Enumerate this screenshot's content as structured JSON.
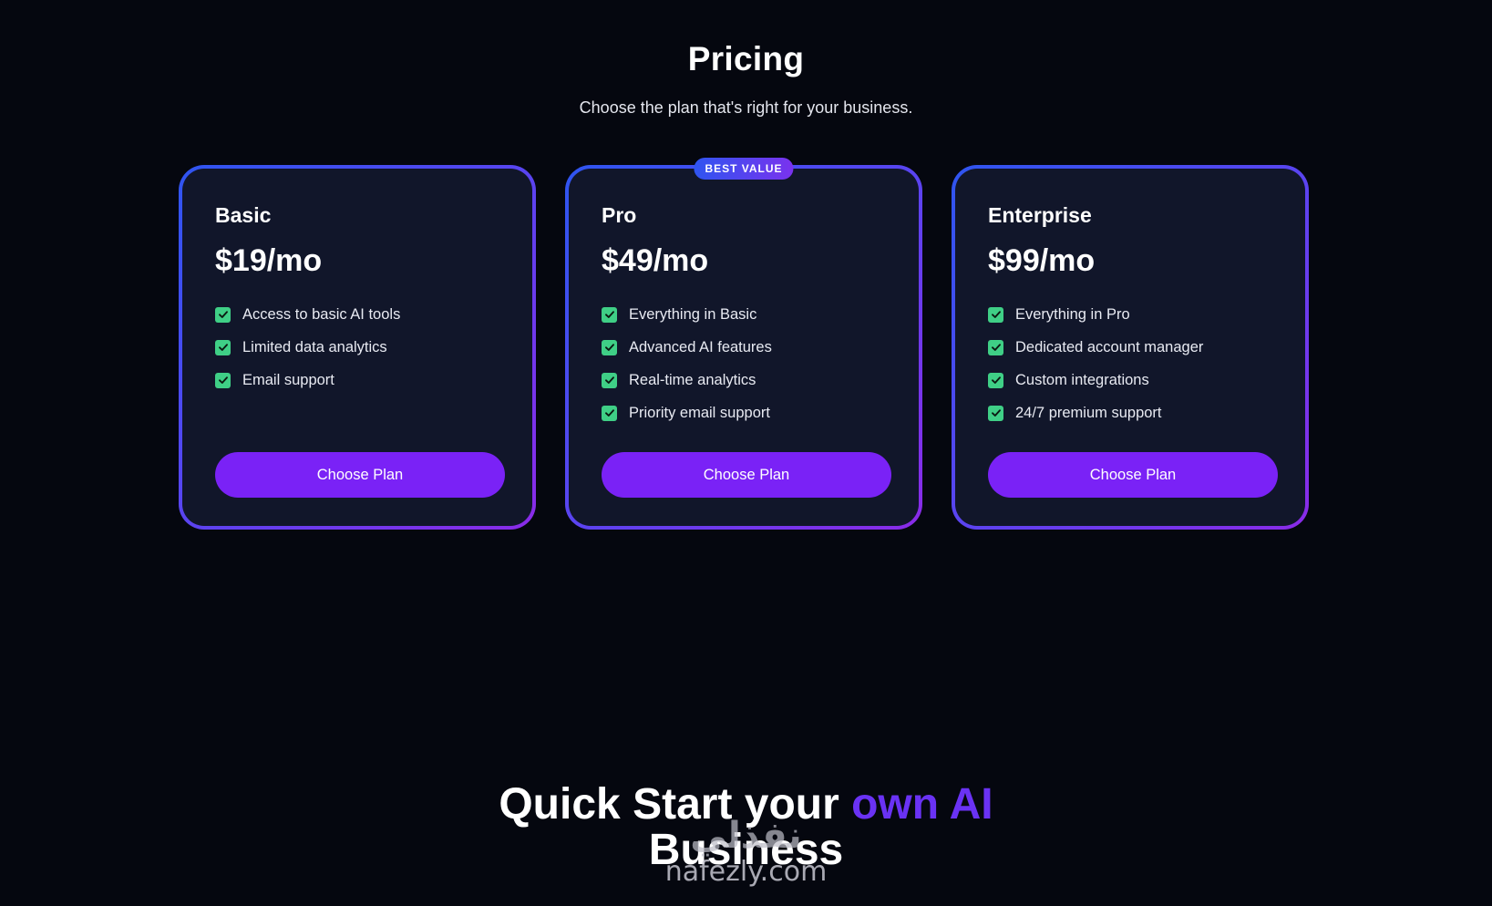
{
  "pricing": {
    "title": "Pricing",
    "subtitle": "Choose the plan that's right for your business."
  },
  "plans": [
    {
      "name": "Basic",
      "price": "$19/mo",
      "badge": "",
      "features": [
        "Access to basic AI tools",
        "Limited data analytics",
        "Email support"
      ],
      "button_label": "Choose Plan"
    },
    {
      "name": "Pro",
      "price": "$49/mo",
      "badge": "BEST VALUE",
      "features": [
        "Everything in Basic",
        "Advanced AI features",
        "Real-time analytics",
        "Priority email support"
      ],
      "button_label": "Choose Plan"
    },
    {
      "name": "Enterprise",
      "price": "$99/mo",
      "badge": "",
      "features": [
        "Everything in Pro",
        "Dedicated account manager",
        "Custom integrations",
        "24/7 premium support"
      ],
      "button_label": "Choose Plan"
    }
  ],
  "quick_start": {
    "line1_prefix": "Quick Start your ",
    "line1_accent": "own AI",
    "line2": "Business"
  },
  "watermark": {
    "arabic": "نفذلي",
    "latin": "nafezly.com"
  },
  "colors": {
    "background": "#05070f",
    "card_background": "#11162a",
    "accent_purple": "#7a22f6",
    "gradient_blue": "#2f55f0",
    "gradient_purple": "#8a2be8",
    "check_green": "#3fcf86",
    "headline_accent": "#6a32f4"
  },
  "icons": {
    "feature_check": "check-square-icon"
  }
}
